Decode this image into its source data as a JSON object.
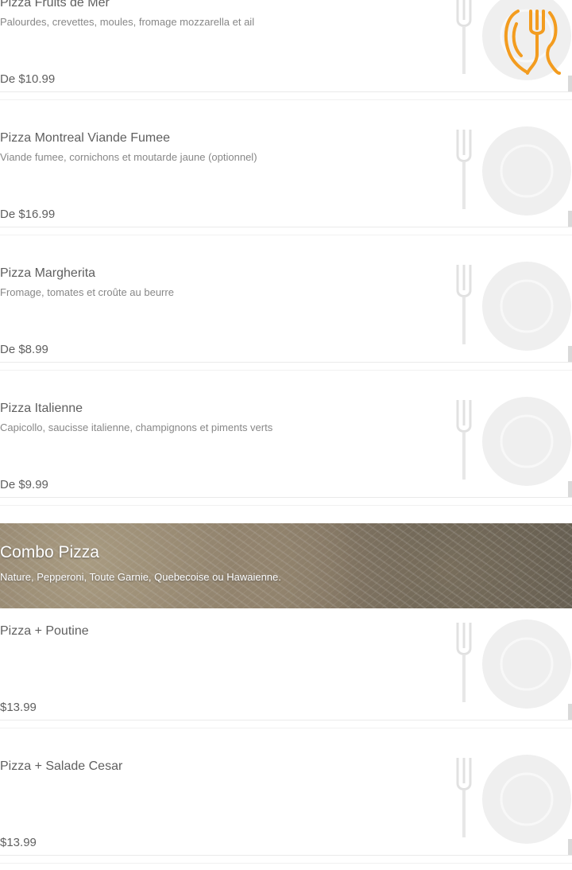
{
  "colors": {
    "accent": "#f39c1f",
    "text": "#333333",
    "muted": "#666666",
    "divider": "#e4e4e4"
  },
  "logo": {
    "icon": "fork-and-plate-logo-icon"
  },
  "menu": {
    "items_top": [
      {
        "name": "Pizza Fruits de Mer",
        "description": "Palourdes, crevettes, moules, fromage mozzarella et ail",
        "price": "De $10.99",
        "image_icon": "placeholder-plate-icon"
      },
      {
        "name": "Pizza Montreal Viande Fumee",
        "description": "Viande fumee, cornichons et moutarde jaune (optionnel)",
        "price": "De $16.99",
        "image_icon": "placeholder-plate-icon"
      },
      {
        "name": "Pizza Margherita",
        "description": "Fromage, tomates et croûte au beurre",
        "price": "De $8.99",
        "image_icon": "placeholder-plate-icon"
      },
      {
        "name": "Pizza Italienne",
        "description": "Capicollo, saucisse italienne, champignons et piments verts",
        "price": "De $9.99",
        "image_icon": "placeholder-plate-icon"
      }
    ],
    "category": {
      "title": "Combo Pizza",
      "description": "Nature, Pepperoni, Toute Garnie, Quebecoise ou Hawaienne."
    },
    "items_bottom": [
      {
        "name": "Pizza + Poutine",
        "description": "",
        "price": "$13.99",
        "image_icon": "placeholder-plate-icon"
      },
      {
        "name": "Pizza + Salade Cesar",
        "description": "",
        "price": "$13.99",
        "image_icon": "placeholder-plate-icon"
      }
    ]
  }
}
